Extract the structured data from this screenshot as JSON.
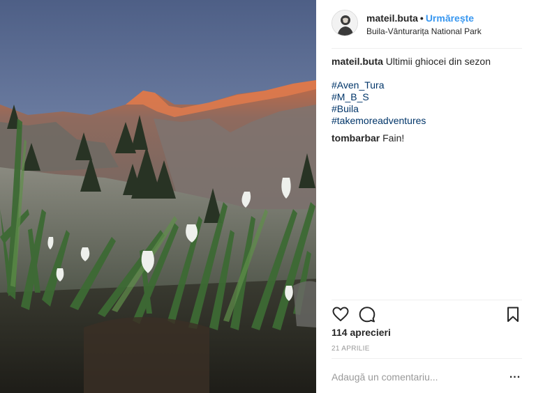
{
  "post": {
    "image_alt": "snowdrop flowers in front of mountain peak at sunset"
  },
  "header": {
    "username": "mateil.buta",
    "separator": "•",
    "follow_label": "Urmărește",
    "location": "Buila-Vânturarița National Park",
    "avatar_icon": "user-avatar"
  },
  "caption": {
    "username": "mateil.buta",
    "text": "Ultimii ghiocei din sezon",
    "hashtags": [
      "#Aven_Tura",
      "#M_B_S",
      "#Buila",
      "#takemoreadventures"
    ]
  },
  "comments": [
    {
      "username": "tombarbar",
      "text": "Fain!"
    }
  ],
  "actions": {
    "like_icon": "heart-icon",
    "comment_icon": "comment-icon",
    "save_icon": "bookmark-icon"
  },
  "likes_text": "114 aprecieri",
  "date_text": "21 APRILIE",
  "add_comment": {
    "placeholder": "Adaugă un comentariu...",
    "more_label": "..."
  },
  "colors": {
    "follow": "#3897f0",
    "hashtag": "#003569",
    "muted": "#999999",
    "text": "#262626"
  }
}
